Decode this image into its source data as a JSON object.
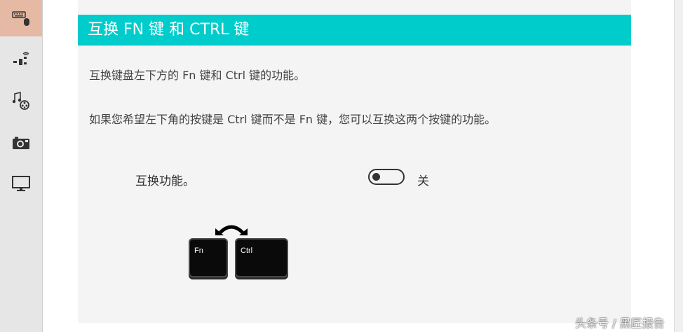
{
  "sidebar": {
    "items": [
      {
        "icon": "keyboard-mouse-icon",
        "active": true
      },
      {
        "icon": "network-wireless-icon",
        "active": false
      },
      {
        "icon": "music-video-icon",
        "active": false
      },
      {
        "icon": "camera-icon",
        "active": false
      },
      {
        "icon": "monitor-icon",
        "active": false
      }
    ]
  },
  "section": {
    "title": "互换 FN 键 和 CTRL 键",
    "description_1": "互换键盘左下方的 Fn 键和 Ctrl 键的功能。",
    "description_2": "如果您希望左下角的按键是 Ctrl 键而不是 Fn 键，您可以互换这两个按键的功能。"
  },
  "toggle": {
    "label": "互换功能。",
    "state_text": "关",
    "on": false
  },
  "illustration": {
    "key_left": "Fn",
    "key_right": "Ctrl"
  },
  "watermark": "头条号 / 黑匠报告",
  "colors": {
    "header_bg": "#00cccc",
    "active_rail_bg": "#e5b9a3",
    "panel_bg": "#f4f4f4"
  }
}
